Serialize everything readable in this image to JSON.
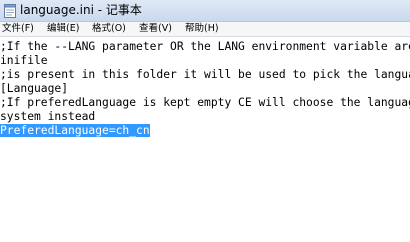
{
  "window": {
    "title": "language.ini - 记事本"
  },
  "menu": [
    {
      "label": "文件(F)"
    },
    {
      "label": "编辑(E)"
    },
    {
      "label": "格式(O)"
    },
    {
      "label": "查看(V)"
    },
    {
      "label": "帮助(H)"
    }
  ],
  "editor": {
    "lines": [
      ";If the --LANG parameter OR the LANG environment variable are",
      "inifile",
      ";is present in this folder it will be used to pick the langua",
      "[Language]",
      ";If preferedLanguage is kept empty CE will choose the languag",
      "system instead"
    ],
    "selected_line": "PreferedLanguage=ch_cn"
  },
  "colors": {
    "selection": "#3399ff",
    "titlebar": "#dfe9f5"
  }
}
